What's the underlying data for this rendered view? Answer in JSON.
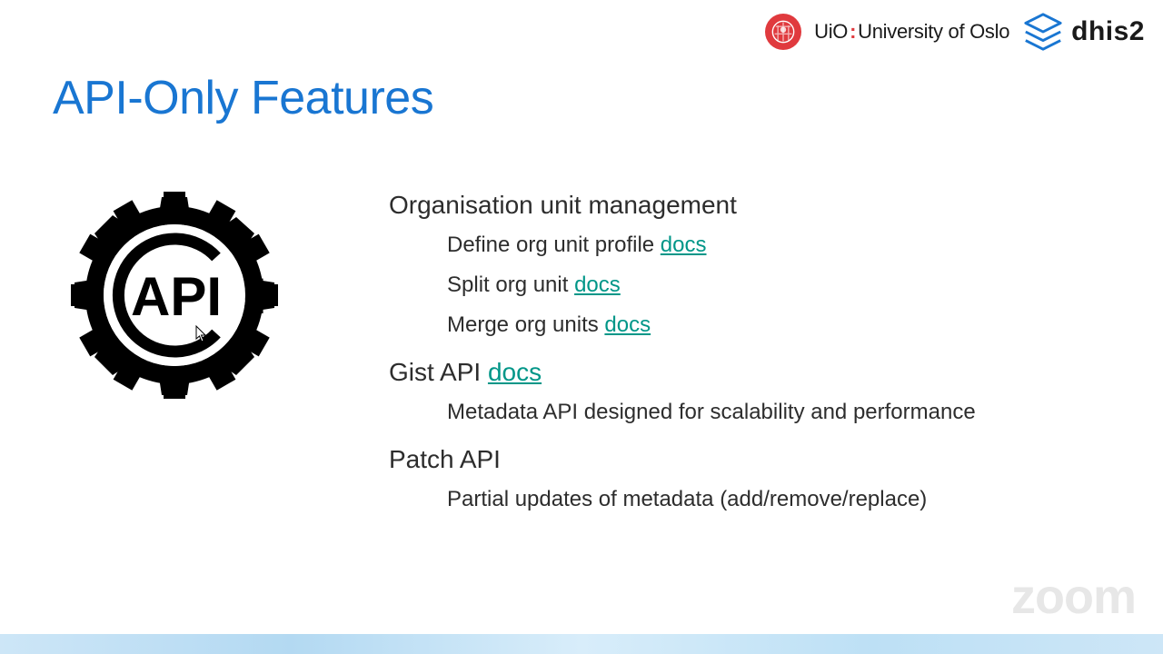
{
  "logos": {
    "uio_short": "UiO",
    "uio_separator": ":",
    "uio_full": "University of Oslo",
    "dhis2": "dhis2"
  },
  "title": "API-Only Features",
  "section1": {
    "heading": "Organisation unit management",
    "items": [
      {
        "text": "Define org unit profile ",
        "link": "docs"
      },
      {
        "text": "Split org unit ",
        "link": "docs"
      },
      {
        "text": "Merge org units ",
        "link": "docs"
      }
    ]
  },
  "section2": {
    "heading": "Gist API ",
    "heading_link": "docs",
    "items": [
      {
        "text": "Metadata API designed for scalability and performance"
      }
    ]
  },
  "section3": {
    "heading": "Patch API",
    "items": [
      {
        "text": "Partial updates of metadata (add/remove/replace)"
      }
    ]
  },
  "watermark": "zoom",
  "icon_label": "API"
}
